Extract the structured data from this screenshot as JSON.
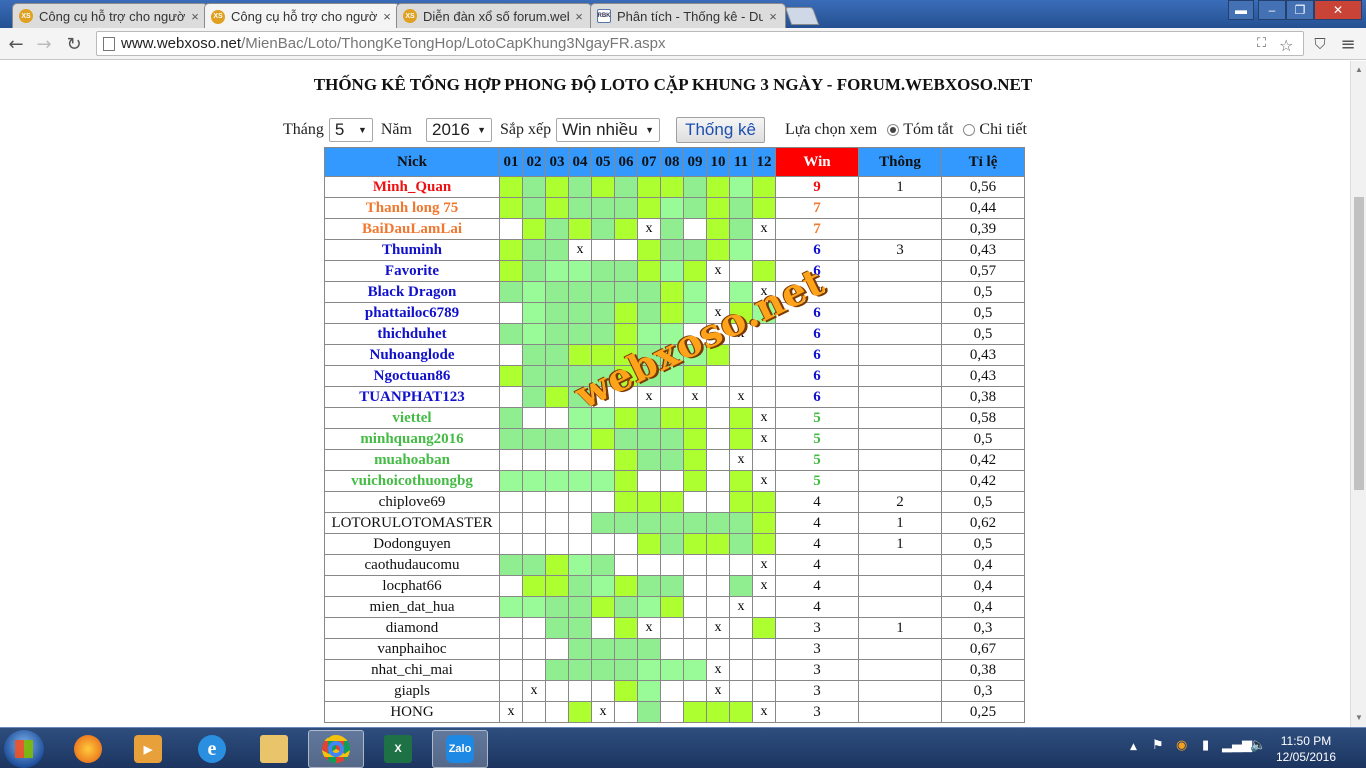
{
  "browser": {
    "tabs": [
      {
        "title": "Công cụ hỗ trợ cho người",
        "favicon": "XS",
        "active": false
      },
      {
        "title": "Công cụ hỗ trợ cho người",
        "favicon": "XS",
        "active": true
      },
      {
        "title": "Diễn đàn xổ số forum.web",
        "favicon": "XS",
        "active": false
      },
      {
        "title": "Phân tích - Thống kê - Dư",
        "favicon": "RBK",
        "active": false
      }
    ],
    "url_host": "www.webxoso.net",
    "url_path": "/MienBac/Loto/ThongKeTongHop/LotoCapKhung3NgayFR.aspx"
  },
  "page": {
    "title": "THỐNG KÊ TỔNG HỢP PHONG ĐỘ LOTO CẶP KHUNG 3 NGÀY - FORUM.WEBXOSO.NET",
    "filters": {
      "month_label": "Tháng",
      "month_value": "5",
      "year_label": "Năm",
      "year_value": "2016",
      "sort_label": "Sắp xếp",
      "sort_value": "Win nhiều",
      "submit_label": "Thống kê",
      "view_label": "Lựa chọn xem",
      "view_summary": "Tóm tắt",
      "view_detail": "Chi tiết"
    },
    "watermark": "webxoso.net",
    "table": {
      "headers": {
        "nick": "Nick",
        "days": [
          "01",
          "02",
          "03",
          "04",
          "05",
          "06",
          "07",
          "08",
          "09",
          "10",
          "11",
          "12"
        ],
        "win": "Win",
        "thong": "Thông",
        "ratio": "Tỉ lệ"
      },
      "rows": [
        {
          "nick": "Minh_Quan",
          "cls": "red",
          "cells": "121212112131",
          "win": "9",
          "thong": "1",
          "ratio": "0,56"
        },
        {
          "nick": "Thanh long 75",
          "cls": "orange",
          "cells": "121222132121",
          "win": "7",
          "thong": "",
          "ratio": "0,44"
        },
        {
          "nick": "BaiDauLamLai",
          "cls": "orange",
          "cells": "012121x2012x",
          "win": "7",
          "thong": "",
          "ratio": "0,39"
        },
        {
          "nick": "Thuminh",
          "cls": "blue",
          "cells": "122x0012213 ",
          "win": "6",
          "thong": "3",
          "ratio": "0,43"
        },
        {
          "nick": "Favorite",
          "cls": "blue",
          "cells": "123322131x01",
          "win": "6",
          "thong": "",
          "ratio": "0,57"
        },
        {
          "nick": "Black Dragon",
          "cls": "blue",
          "cells": "232222213 3x",
          "win": "6",
          "thong": "",
          "ratio": "0,5"
        },
        {
          "nick": "phattailoc6789",
          "cls": "blue",
          "cells": "032221213x13",
          "win": "6",
          "thong": "",
          "ratio": "0,5"
        },
        {
          "nick": "thichduhet",
          "cls": "blue",
          "cells": "232221330 x0",
          "win": "6",
          "thong": "",
          "ratio": "0,5"
        },
        {
          "nick": "Nuhoanglode",
          "cls": "blue",
          "cells": "022111233100",
          "win": "6",
          "thong": "",
          "ratio": "0,43"
        },
        {
          "nick": "Ngoctuan86",
          "cls": "blue",
          "cells": "122221231000",
          "win": "6",
          "thong": "",
          "ratio": "0,43"
        },
        {
          "nick": "TUANPHAT123",
          "cls": "blue",
          "cells": "021200x x0x0",
          "win": "6",
          "thong": "",
          "ratio": "0,38"
        },
        {
          "nick": "viettel",
          "cls": "green",
          "cells": "200331211 1x",
          "win": "5",
          "thong": "",
          "ratio": "0,58"
        },
        {
          "nick": "minhquang2016",
          "cls": "green",
          "cells": "222312221 1x",
          "win": "5",
          "thong": "",
          "ratio": "0,5"
        },
        {
          "nick": "muahoaban",
          "cls": "green",
          "cells": "000001221 x0",
          "win": "5",
          "thong": "",
          "ratio": "0,42"
        },
        {
          "nick": "vuichoicothuongbg",
          "cls": "green",
          "cells": "333331001 1x",
          "win": "5",
          "thong": "",
          "ratio": "0,42"
        },
        {
          "nick": "chiplove69",
          "cls": "black",
          "cells": "000001110011",
          "win": "4",
          "thong": "2",
          "ratio": "0,5"
        },
        {
          "nick": "LOTORULOTOMASTER",
          "cls": "black",
          "cells": "000022222221",
          "win": "4",
          "thong": "1",
          "ratio": "0,62"
        },
        {
          "nick": "Dodonguyen",
          "cls": "black",
          "cells": "000000121121",
          "win": "4",
          "thong": "1",
          "ratio": "0,5"
        },
        {
          "nick": "caothudaucomu",
          "cls": "black",
          "cells": "221320000 0x",
          "win": "4",
          "thong": "",
          "ratio": "0,4"
        },
        {
          "nick": "locphat66",
          "cls": "black",
          "cells": "011231220 2x",
          "win": "4",
          "thong": "",
          "ratio": "0,4"
        },
        {
          "nick": "mien_dat_hua",
          "cls": "black",
          "cells": "332212310 x0",
          "win": "4",
          "thong": "",
          "ratio": "0,4"
        },
        {
          "nick": "diamond",
          "cls": "black",
          "cells": "002201x00x01",
          "win": "3",
          "thong": "1",
          "ratio": "0,3"
        },
        {
          "nick": "vanphaihoc",
          "cls": "black",
          "cells": "000222200000",
          "win": "3",
          "thong": "",
          "ratio": "0,67"
        },
        {
          "nick": "nhat_chi_mai",
          "cls": "black",
          "cells": "002222333x00",
          "win": "3",
          "thong": "",
          "ratio": "0,38"
        },
        {
          "nick": "giapls",
          "cls": "black",
          "cells": "0x0001300x00",
          "win": "3",
          "thong": "",
          "ratio": "0,3"
        },
        {
          "nick": "HONG",
          "cls": "black",
          "cells": "x001x02 111x",
          "win": "3",
          "thong": "",
          "ratio": "0,25"
        }
      ]
    }
  },
  "taskbar": {
    "apps": [
      "Firefox",
      "Media Player",
      "Internet Explorer",
      "Explorer",
      "Chrome",
      "Excel",
      "Zalo"
    ],
    "time": "11:50 PM",
    "date": "12/05/2016"
  }
}
